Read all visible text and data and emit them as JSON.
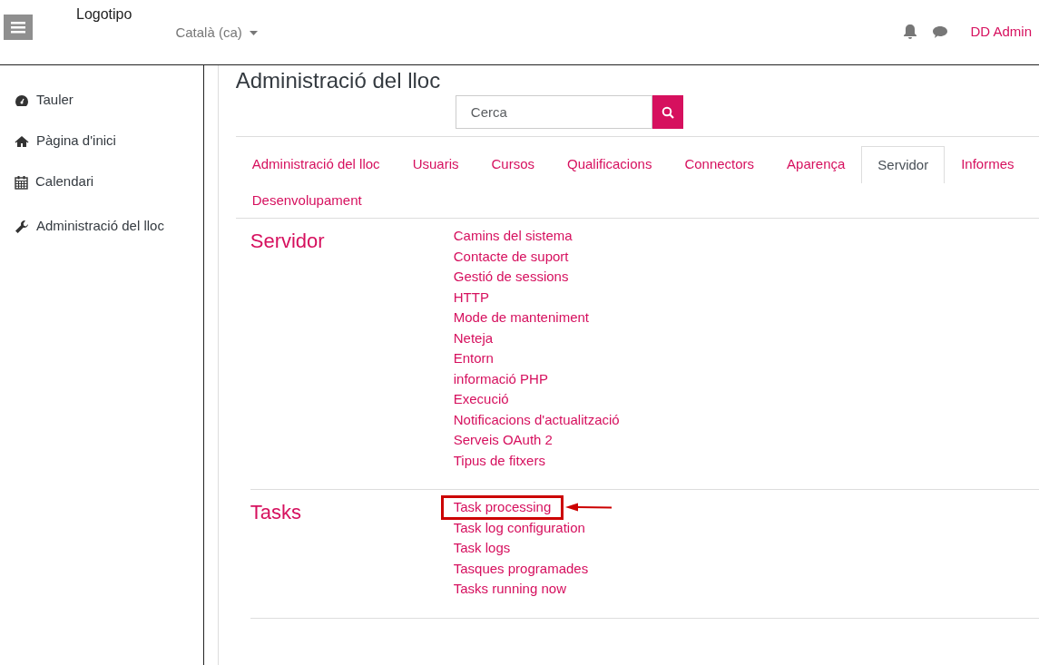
{
  "navbar": {
    "logo": "Logotipo",
    "language": "Català (ca)",
    "user": "DD Admin"
  },
  "sidebar": {
    "items": [
      {
        "label": "Tauler",
        "selected": false
      },
      {
        "label": "Pàgina d'inici",
        "selected": false
      },
      {
        "label": "Calendari",
        "selected": false
      },
      {
        "label": "Administració del lloc",
        "selected": false
      }
    ]
  },
  "page_title": "Administració del lloc",
  "search": {
    "placeholder": "Cerca"
  },
  "tabs": [
    {
      "label": "Administració del lloc",
      "selected": false
    },
    {
      "label": "Usuaris",
      "selected": false
    },
    {
      "label": "Cursos",
      "selected": false
    },
    {
      "label": "Qualificacions",
      "selected": false
    },
    {
      "label": "Connectors",
      "selected": false
    },
    {
      "label": "Aparença",
      "selected": false
    },
    {
      "label": "Servidor",
      "selected": true
    },
    {
      "label": "Informes",
      "selected": false
    },
    {
      "label": "Desenvolupament",
      "selected": false
    }
  ],
  "sections": [
    {
      "title": "Servidor",
      "links": [
        {
          "label": "Camins del sistema",
          "highlighted": false
        },
        {
          "label": "Contacte de suport",
          "highlighted": false
        },
        {
          "label": "Gestió de sessions",
          "highlighted": false
        },
        {
          "label": "HTTP",
          "highlighted": false
        },
        {
          "label": "Mode de manteniment",
          "highlighted": false
        },
        {
          "label": "Neteja",
          "highlighted": false
        },
        {
          "label": "Entorn",
          "highlighted": false
        },
        {
          "label": "informació PHP",
          "highlighted": false
        },
        {
          "label": "Execució",
          "highlighted": false
        },
        {
          "label": "Notificacions d'actualització",
          "highlighted": false
        },
        {
          "label": "Serveis OAuth 2",
          "highlighted": false
        },
        {
          "label": "Tipus de fitxers",
          "highlighted": false
        }
      ]
    },
    {
      "title": "Tasks",
      "links": [
        {
          "label": "Task processing",
          "highlighted": true
        },
        {
          "label": "Task log configuration",
          "highlighted": false
        },
        {
          "label": "Task logs",
          "highlighted": false
        },
        {
          "label": "Tasques programades",
          "highlighted": false
        },
        {
          "label": "Tasks running now",
          "highlighted": false
        }
      ]
    }
  ]
}
